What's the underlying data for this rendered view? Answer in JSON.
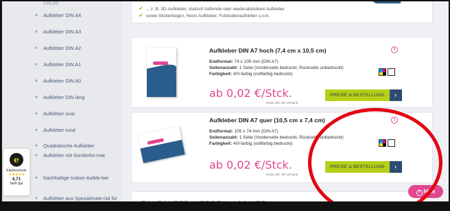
{
  "sidebar": {
    "items": [
      {
        "label": "DIN A5"
      },
      {
        "label": "Aufkleber DIN A4"
      },
      {
        "label": "Aufkleber DIN A3"
      },
      {
        "label": "Aufkleber DIN A2"
      },
      {
        "label": "Aufkleber DIN A1"
      },
      {
        "label": "Aufkleber DIN A0"
      },
      {
        "label": "Aufkleber DIN lang"
      },
      {
        "label": "Aufkleber oval"
      },
      {
        "label": "Aufkleber rund"
      },
      {
        "label": "Quadratische Aufkleber"
      },
      {
        "label": "Aufkleber mit Sonderfor-mat"
      },
      {
        "label": "Nachhaltige Indoor-Aufkle-ber"
      },
      {
        "label": "Aufkleber aus Spezialmate-rial für Indoor & Outdoor"
      }
    ]
  },
  "features": [
    "... z. B. 3D-Aufkleber, statisch haftende oder wiederablösbare Aufkleber",
    "sowie Stickerbögen, Neon-Aufkleber, Fußbodenaufkleber u.v.m."
  ],
  "products": [
    {
      "title": "Aufkleber DIN A7 hoch (7,4 cm x 10,5 cm)",
      "endformat_label": "Endformat:",
      "endformat": "74 x 105 mm (DIN A7)",
      "seiten_label": "Seitenanzahl:",
      "seiten": "1 Seite (Vorderseite bedruckt, Rückseite unbedruckt)",
      "farb_label": "Farbigkeit:",
      "farb": "4/0-farbig (vollfarbig bedruckt)",
      "price": "ab 0,02 €/Stck.",
      "price_note": "brutto inkl. DE-Versand",
      "button": "PREISE & BESTELLUNG",
      "button_arrow": "›",
      "info": "i"
    },
    {
      "title": "Aufkleber DIN A7 quer (10,5 cm x 7,4 cm)",
      "endformat_label": "Endformat:",
      "endformat": "105 x 74 mm (DIN A7)",
      "seiten_label": "Seitenanzahl:",
      "seiten": "1 Seite (Vorderseite bedruckt, Rückseite unbedruckt)",
      "farb_label": "Farbigkeit:",
      "farb": "4/0-farbig (vollfarbig bedruckt)",
      "price": "ab 0,02 €/Stck.",
      "price_note": "brutto inkl. DE-Versand",
      "button": "PREISE & BESTELLUNG",
      "button_arrow": "›",
      "info": "i"
    }
  ],
  "bottom_heading": "EIN ECHTER WERBEKLASSIKER",
  "badge": {
    "label": "Käuferschutz",
    "stars": "★★★★★",
    "rating": "4,71",
    "rating_text": "Sehr gut",
    "more": "...",
    "seal": "e"
  },
  "help": {
    "label": "Hilfe",
    "icon": "?"
  },
  "colors": {
    "accent_pink": "#e0478f",
    "accent_green": "#b6cf17",
    "navy": "#2e4b74",
    "annotation_red": "#e30613"
  }
}
